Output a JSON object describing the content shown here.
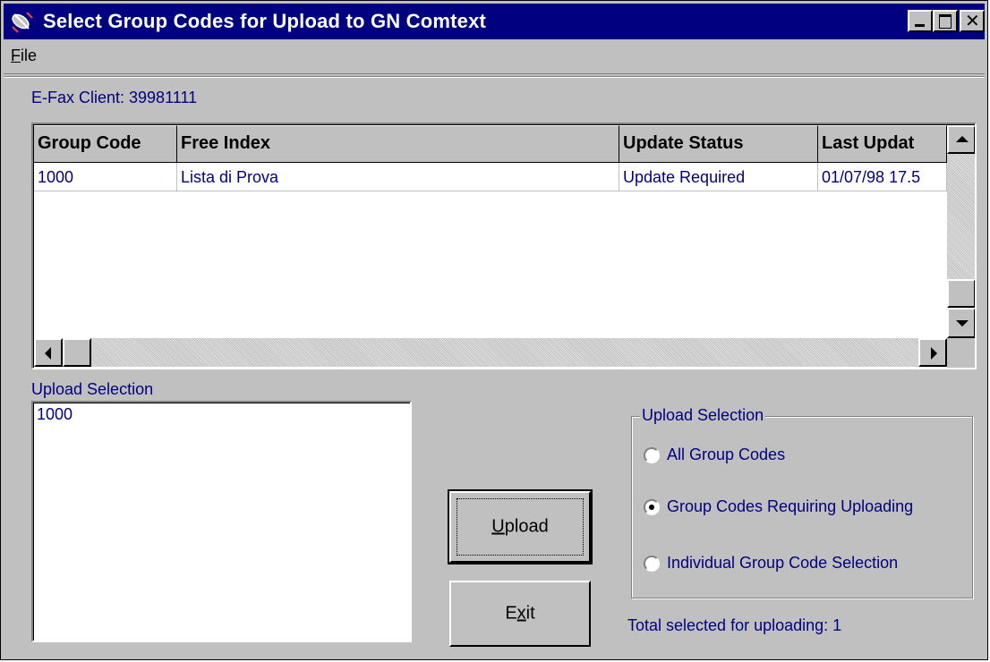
{
  "window": {
    "title": "Select Group Codes for Upload to GN Comtext",
    "icon": "satellite-dish-icon"
  },
  "menu": {
    "file_label": "File",
    "file_mnemonic": "F",
    "file_rest": "ile"
  },
  "client": {
    "label": "E-Fax Client:  39981111"
  },
  "grid": {
    "columns": [
      "Group Code",
      "Free Index",
      "Update Status",
      "Last Updat"
    ],
    "rows": [
      [
        "1000",
        "Lista di Prova",
        "Update Required",
        "01/07/98 17.5"
      ]
    ]
  },
  "upload_list": {
    "label": "Upload Selection",
    "items": [
      "1000"
    ]
  },
  "buttons": {
    "upload_label": "Upload",
    "upload_mnemonic": "U",
    "upload_rest": "pload",
    "exit_label": "Exit",
    "exit_pre": "E",
    "exit_mnemonic": "x",
    "exit_rest": "it"
  },
  "options": {
    "title": "Upload Selection",
    "items": [
      {
        "label": "All Group Codes",
        "selected": false
      },
      {
        "label": "Group Codes Requiring Uploading",
        "selected": true
      },
      {
        "label": "Individual Group Code Selection",
        "selected": false
      }
    ]
  },
  "status": {
    "total_selected": "Total selected for uploading:  1"
  },
  "colors": {
    "title_bar": "#000080",
    "face": "#c0c0c0",
    "text_accent": "#000080"
  }
}
